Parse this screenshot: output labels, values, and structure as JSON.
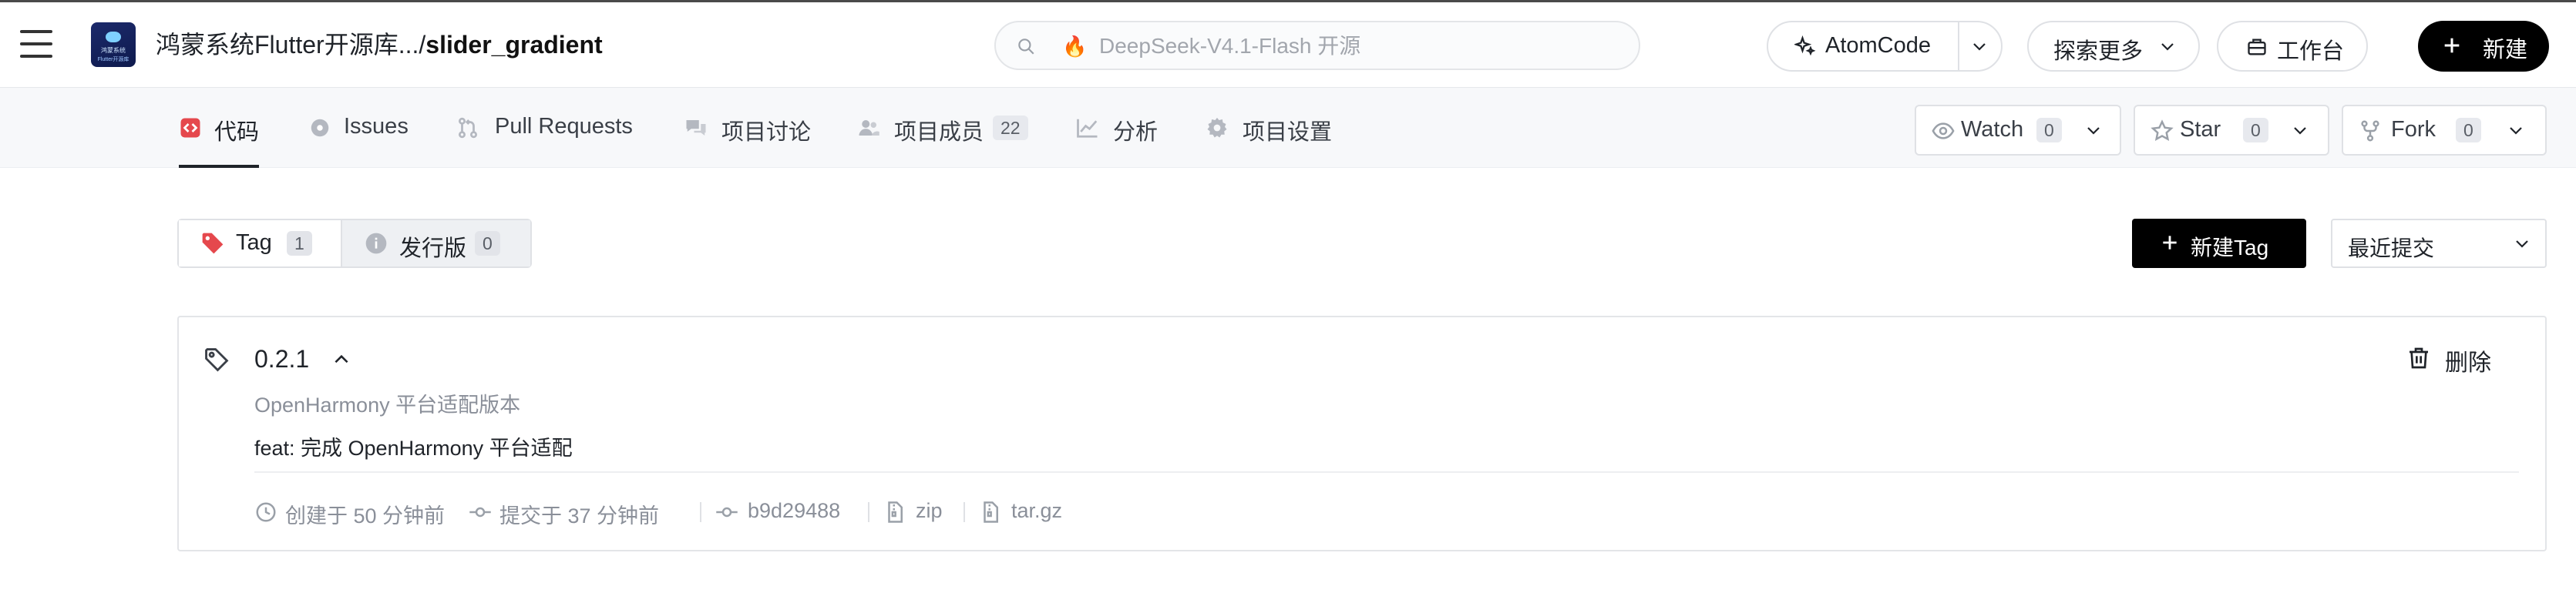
{
  "header": {
    "repo_org": "鸿蒙系统Flutter开源库...",
    "repo_sep": "/",
    "repo_name": "slider_gradient",
    "logo_line1": "鸿蒙系统",
    "logo_line2": "Flutter开源库",
    "search_placeholder": "DeepSeek-V4.1-Flash 开源",
    "search_badge_icon": "fire-icon",
    "atomcode_label": "AtomCode",
    "explore_label": "探索更多",
    "workbench_label": "工作台",
    "new_label": "新建"
  },
  "nav": {
    "tabs": [
      {
        "label": "代码",
        "icon": "code-icon",
        "active": true
      },
      {
        "label": "Issues",
        "icon": "issue-icon"
      },
      {
        "label": "Pull Requests",
        "icon": "pull-request-icon"
      },
      {
        "label": "项目讨论",
        "icon": "discussion-icon"
      },
      {
        "label": "项目成员",
        "icon": "members-icon",
        "count": "22"
      },
      {
        "label": "分析",
        "icon": "analytics-icon"
      },
      {
        "label": "项目设置",
        "icon": "settings-icon"
      }
    ],
    "watch": {
      "label": "Watch",
      "count": "0"
    },
    "star": {
      "label": "Star",
      "count": "0"
    },
    "fork": {
      "label": "Fork",
      "count": "0"
    }
  },
  "toolbar": {
    "tag_tab": {
      "label": "Tag",
      "count": "1"
    },
    "release_tab": {
      "label": "发行版",
      "count": "0"
    },
    "new_tag_label": "新建Tag",
    "sort_label": "最近提交"
  },
  "tags": [
    {
      "name": "0.2.1",
      "subtitle": "OpenHarmony 平台适配版本",
      "message": "feat: 完成 OpenHarmony 平台适配",
      "delete_label": "删除",
      "created": "创建于 50 分钟前",
      "committed": "提交于 37 分钟前",
      "commit_hash": "b9d29488",
      "download_zip": "zip",
      "download_targz": "tar.gz"
    }
  ],
  "colors": {
    "accent": "#000000",
    "tag_icon_red": "#e5484d",
    "muted_text": "#8a8f99",
    "nav_bg": "#f7f8fa"
  }
}
